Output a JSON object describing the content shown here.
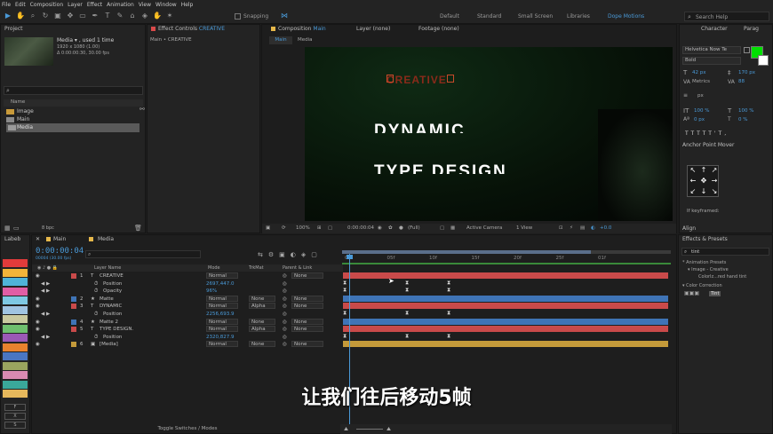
{
  "menu": [
    "File",
    "Edit",
    "Composition",
    "Layer",
    "Effect",
    "Animation",
    "View",
    "Window",
    "Help"
  ],
  "toolbar": {
    "snapping": "Snapping",
    "workspaces": [
      "Default",
      "Standard",
      "Small Screen",
      "Libraries",
      "Dope Motions"
    ],
    "search": "Search Help"
  },
  "project": {
    "title": "Project",
    "item_name": "Media ▾ , used 1 time",
    "item_res": "1920 x 1080 (1.00)",
    "item_dur": "Δ 0:00:00:30, 30.00 fps",
    "col_name": "Name",
    "items": [
      "Image",
      "Main",
      "Media"
    ],
    "bpc": "8 bpc"
  },
  "effect_controls": {
    "title": "Effect Controls",
    "layer": "CREATIVE",
    "breadcrumb": "Main • CREATIVE"
  },
  "composition": {
    "title": "Composition",
    "name": "Main",
    "layer_tab": "Layer (none)",
    "footage_tab": "Footage (none)",
    "tabs": [
      "Main",
      "Media"
    ],
    "overlay_word": "CREATIVE",
    "text_line1": "DYNAMIC",
    "text_line2": "TYPE DESIGN",
    "zoom": "100%",
    "timecode": "0:00:00:04",
    "quality": "(Full)",
    "camera": "Active Camera",
    "views": "1 View",
    "exposure": "+0.0"
  },
  "right": {
    "tabs": [
      "Character",
      "Parag"
    ],
    "font": "Helvetica Now Te",
    "style": "Bold",
    "size": "42 px",
    "leading": "170 px",
    "metrics": "Metrics",
    "tracking": "88",
    "stroke": "px",
    "scale_v": "100 %",
    "scale_h": "100 %",
    "baseline": "0 px",
    "tsume": "0 %",
    "fill_color": "#00e000",
    "anchor_title": "Anchor Point Mover",
    "keyframed": "If keyframed:",
    "align": "Align",
    "effects_title": "Effects & Presets",
    "effects_search": "tint",
    "presets": "* Animation Presets",
    "image_creative": "▾ Image - Creative",
    "colorize": "Colorlz...red hand tint",
    "color_correction": "▾ Color Correction",
    "tint": "Tint"
  },
  "timeline": {
    "labels_title": "Labeb",
    "tab": "Main",
    "tab2": "Media",
    "timecode": "0:00:00:04",
    "frames": "00004 (30.00 fps)",
    "cols": {
      "name": "Layer Name",
      "mode": "Mode",
      "trkmat": "TrkMat",
      "parent": "Parent & Link"
    },
    "ticks": [
      "0s",
      "05f",
      "10f",
      "15f",
      "20f",
      "25f",
      "01f"
    ],
    "toggle": "Toggle Switches / Modes",
    "layers": [
      {
        "num": "1",
        "name": "CREATIVE",
        "mode": "Normal",
        "trk": "",
        "parent": "None",
        "color": "#c94a4a",
        "type": "T"
      },
      {
        "num": "",
        "name": "Position",
        "mode": "",
        "value": "2697,447.0",
        "prop": true
      },
      {
        "num": "",
        "name": "Opacity",
        "mode": "",
        "value": "96%",
        "prop": true
      },
      {
        "num": "2",
        "name": "Matte",
        "mode": "Normal",
        "trk": "None",
        "parent": "None",
        "color": "#3f74b6",
        "type": "★"
      },
      {
        "num": "3",
        "name": "DYNAMIC",
        "mode": "Normal",
        "trk": "Alpha",
        "parent": "None",
        "color": "#c94a4a",
        "type": "T"
      },
      {
        "num": "",
        "name": "Position",
        "mode": "",
        "value": "2256,693.9",
        "prop": true
      },
      {
        "num": "4",
        "name": "Matte 2",
        "mode": "Normal",
        "trk": "None",
        "parent": "None",
        "color": "#3f74b6",
        "type": "★"
      },
      {
        "num": "5",
        "name": "TYPE DESIGN.",
        "mode": "Normal",
        "trk": "Alpha",
        "parent": "None",
        "color": "#c94a4a",
        "type": "T"
      },
      {
        "num": "",
        "name": "Position",
        "mode": "",
        "value": "2320,827.9",
        "prop": true
      },
      {
        "num": "6",
        "name": "[Media]",
        "mode": "Normal",
        "trk": "None",
        "parent": "None",
        "color": "#c49a3a",
        "type": "▣"
      }
    ]
  },
  "label_colors": [
    "#e23b3b",
    "#f2b43a",
    "#4fb3d8",
    "#e15ea5",
    "#7ec8e3",
    "#a0c4e2",
    "#c9c9a0",
    "#6fbf6f",
    "#9b59b6",
    "#e8822e",
    "#4a76c2",
    "#9aa55f",
    "#d98ab1",
    "#3aa89a",
    "#e6b85c"
  ],
  "subtitle": "让我们往后移动5帧"
}
